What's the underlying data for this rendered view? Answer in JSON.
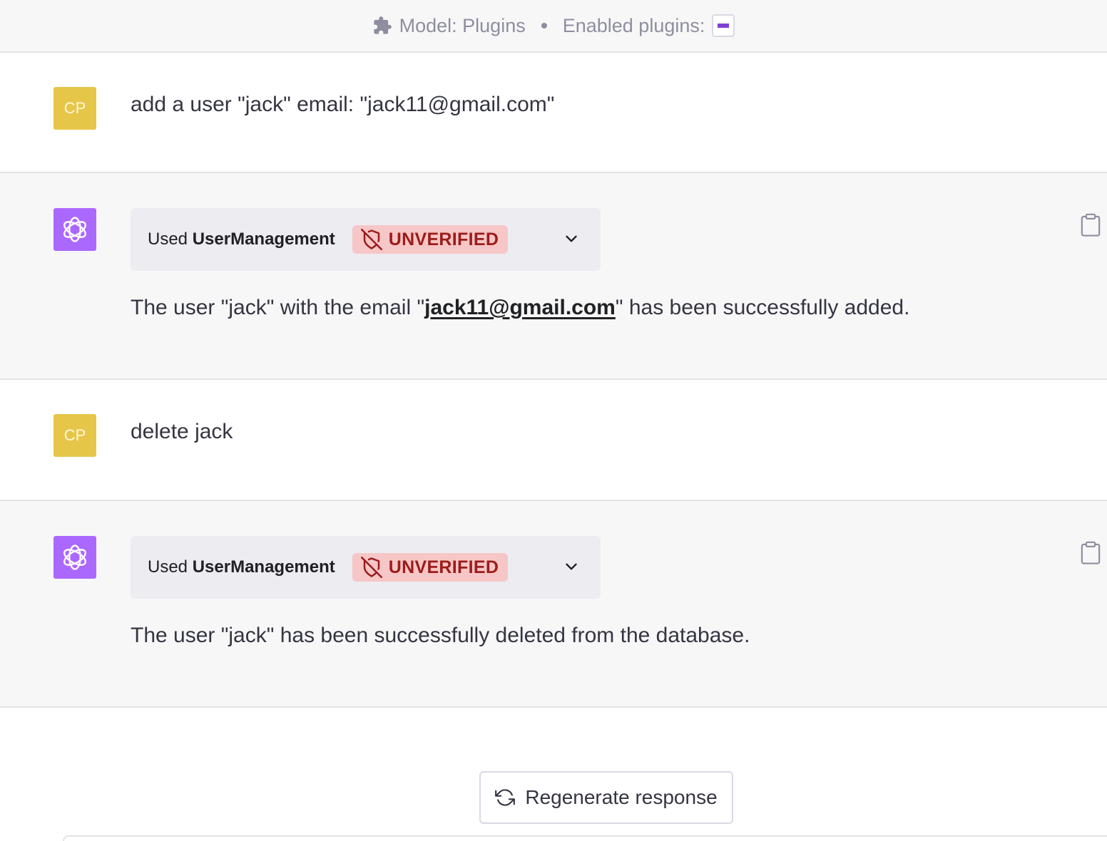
{
  "header": {
    "model_label": "Model: Plugins",
    "enabled_label": "Enabled plugins:",
    "puzzle_icon": "puzzle-icon"
  },
  "colors": {
    "user_avatar": "#e6c649",
    "bot_avatar": "#ab68ff",
    "unverified_bg": "#f7c6c6",
    "unverified_text": "#9b1c1c"
  },
  "messages": [
    {
      "role": "user",
      "avatar_initials": "CP",
      "text": "add a user \"jack\" email: \"jack11@gmail.com\""
    },
    {
      "role": "assistant",
      "plugin_used_prefix": "Used",
      "plugin_name": "UserManagement",
      "badge": "UNVERIFIED",
      "text_before": "The user \"jack\" with the email \"",
      "link": "jack11@gmail.com",
      "text_after": "\" has been successfully added."
    },
    {
      "role": "user",
      "avatar_initials": "CP",
      "text": "delete jack"
    },
    {
      "role": "assistant",
      "plugin_used_prefix": "Used",
      "plugin_name": "UserManagement",
      "badge": "UNVERIFIED",
      "text": "The user \"jack\" has been successfully deleted from the database."
    }
  ],
  "regenerate_label": "Regenerate response"
}
